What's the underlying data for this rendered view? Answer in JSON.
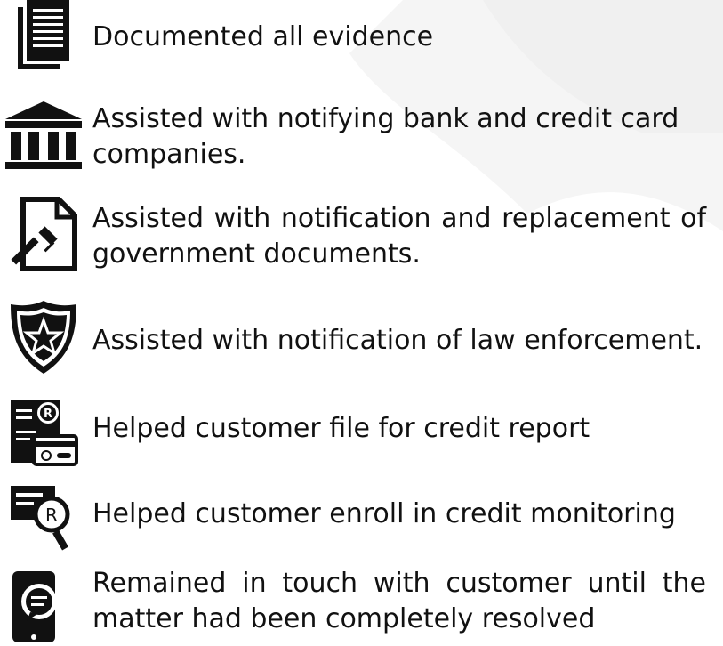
{
  "items": [
    {
      "text": "Documented all evidence",
      "icon": "document-icon"
    },
    {
      "text": "Assisted with notifying bank and credit card companies.",
      "icon": "bank-icon"
    },
    {
      "text": "Assisted with notification and replacement of government documents.",
      "icon": "legal-document-icon"
    },
    {
      "text": "Assisted with notification of law enforcement.",
      "icon": "police-badge-icon"
    },
    {
      "text": "Helped customer file for credit report",
      "icon": "credit-report-icon"
    },
    {
      "text": "Helped customer enroll in credit monitoring",
      "icon": "credit-monitoring-icon"
    },
    {
      "text": "Remained in touch with customer until the matter had been completely resolved",
      "icon": "mobile-chat-icon"
    }
  ],
  "colors": {
    "text": "#111111",
    "icon": "#111111",
    "watermark": "#f5f5f5"
  }
}
